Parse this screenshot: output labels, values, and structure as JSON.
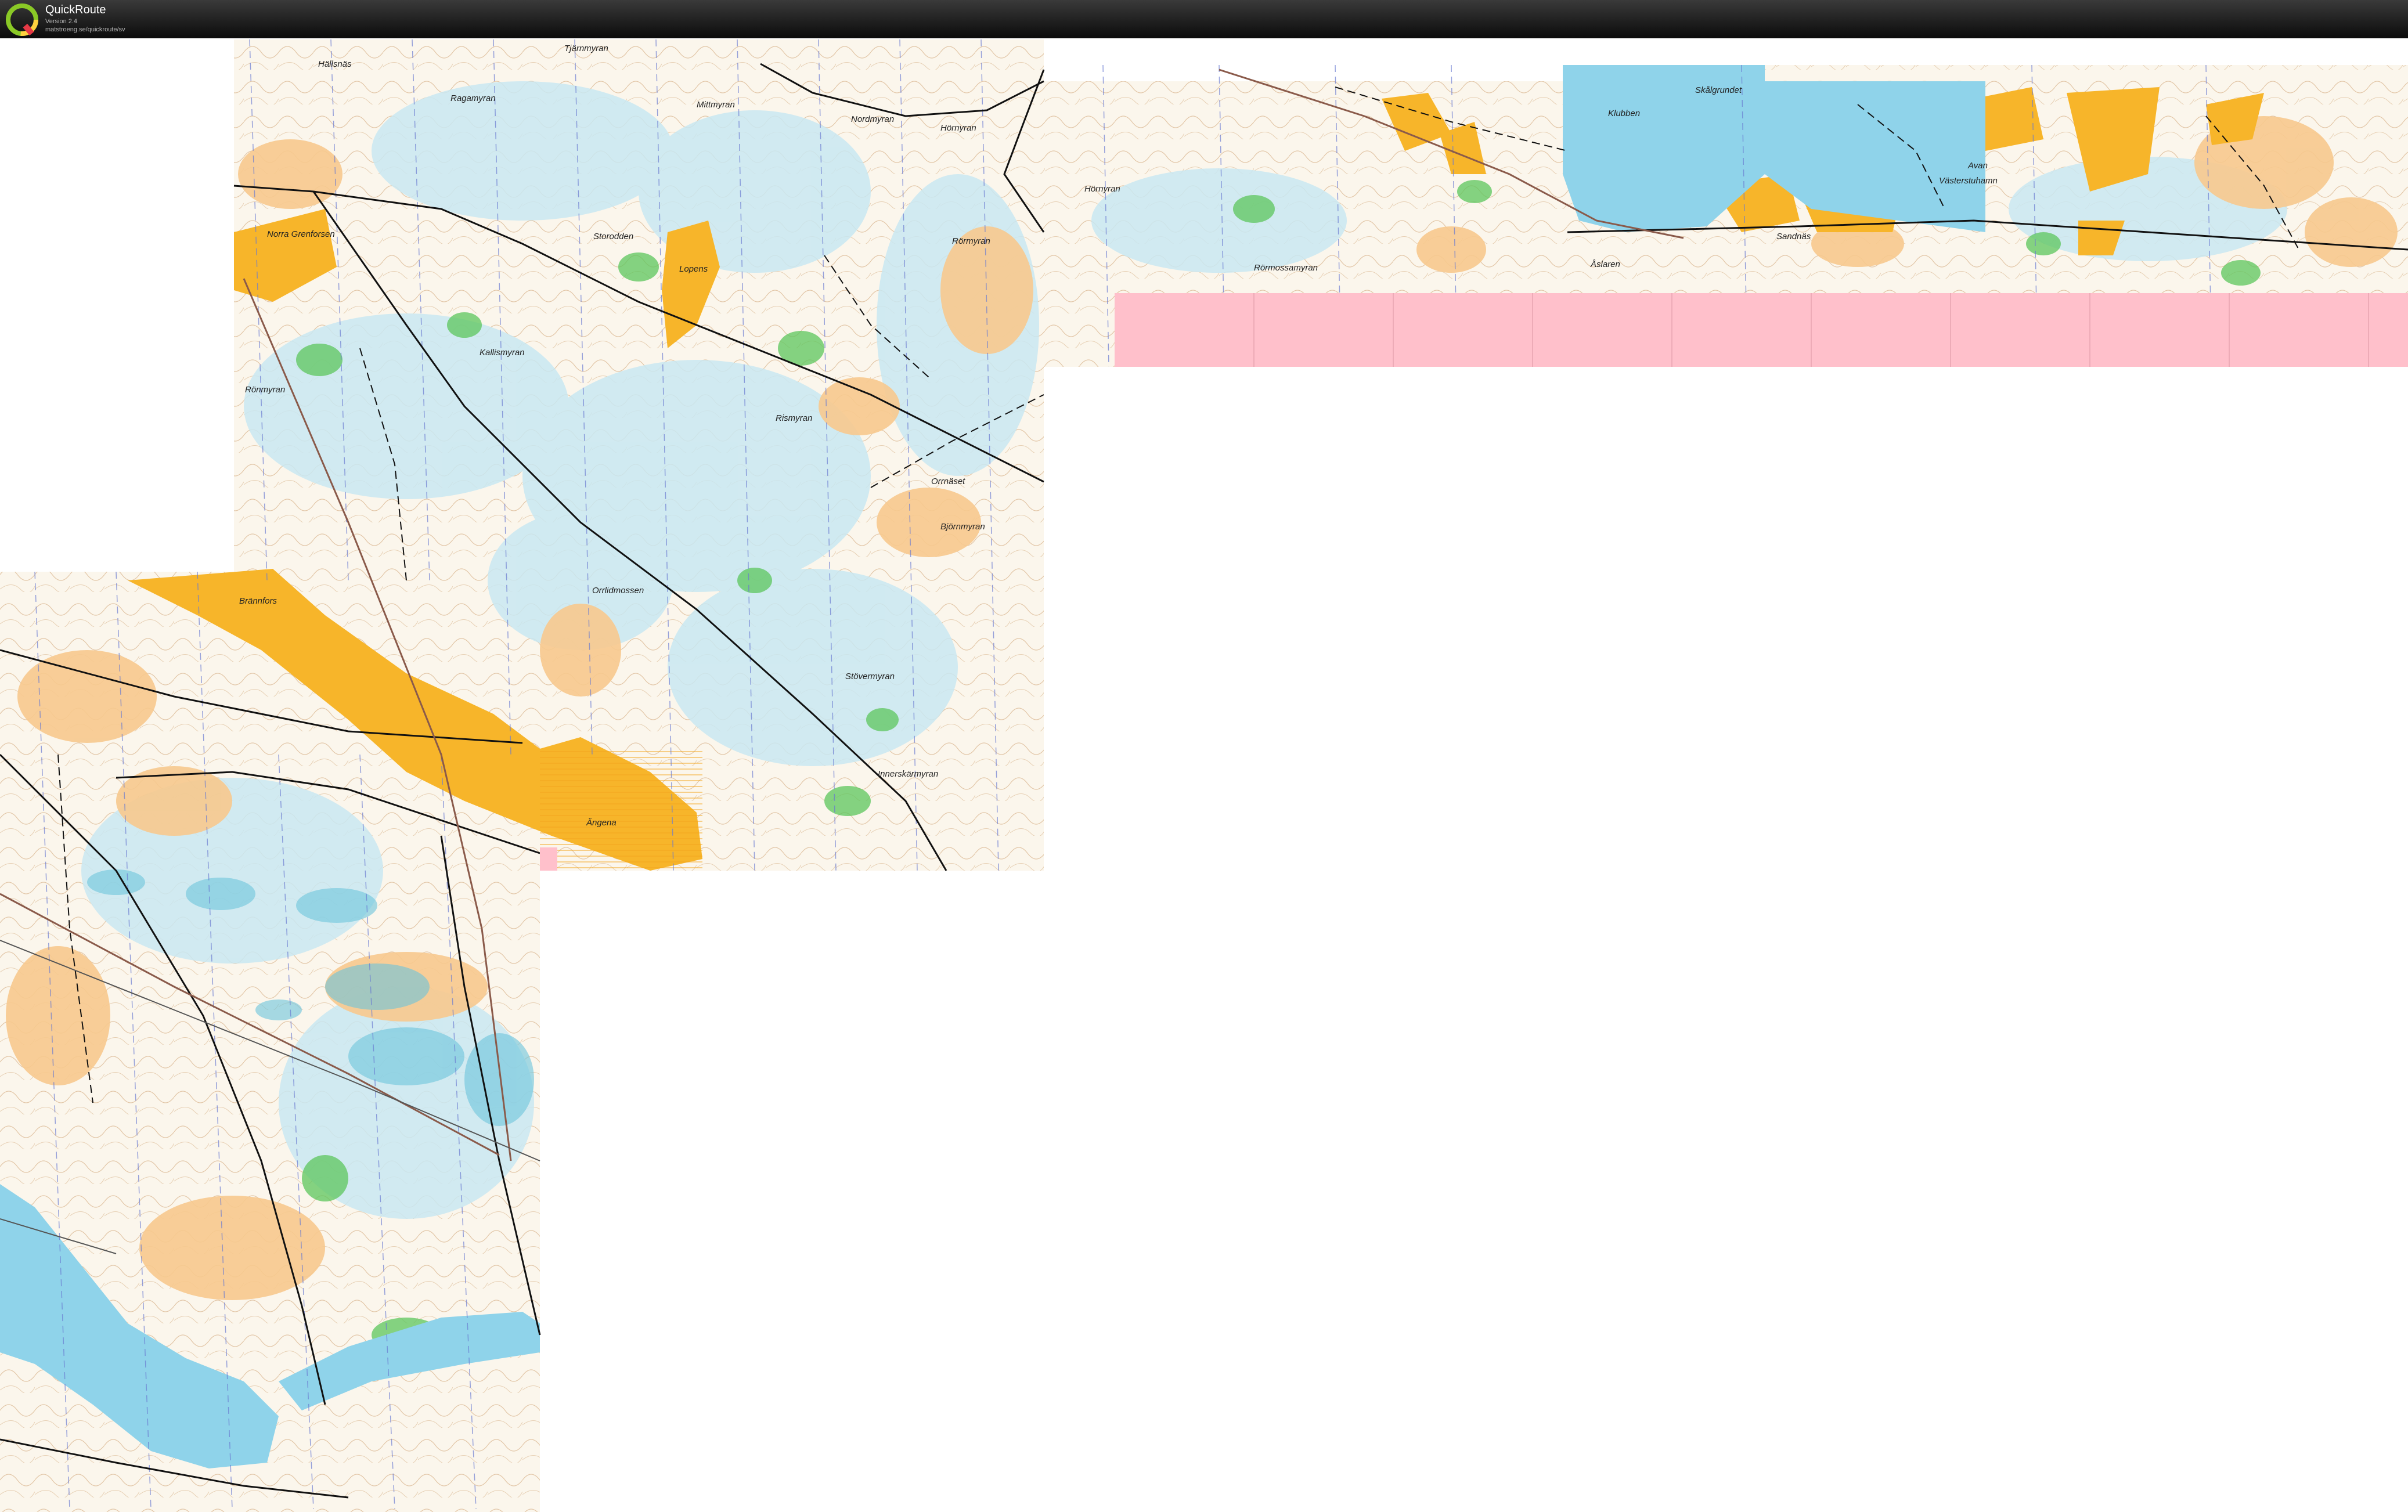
{
  "app": {
    "title": "QuickRoute",
    "version": "Version 2.4",
    "url": "matstroeng.se/quickroute/sv",
    "logo_letter": "Q"
  },
  "map": {
    "colors": {
      "open_land": "#f7c98e",
      "settlement": "#f7b52a",
      "forest_green": "#5cc65c",
      "marsh": "#c9e8f2",
      "water": "#8fd3ea",
      "contours": "#c8a073",
      "missing_tile": "#ffc0cb",
      "road": "#111111"
    },
    "place_names": [
      "Hällsnäs",
      "Ragamyran",
      "Mittmyran",
      "Nordmyran",
      "Hörnyran",
      "Tjärnmyran",
      "Norra Grenforsen",
      "Storodden",
      "Lopens",
      "Rörmyran",
      "Kallismyran",
      "Rismyran",
      "Rönmyran",
      "Orrnäset",
      "Björnmyran",
      "Brännfors",
      "Orrlidmossen",
      "Stövermyran",
      "Innerskärmyran",
      "Ängena",
      "Hörnyran",
      "Rörmossamyran",
      "Klubben",
      "Skålgrundet",
      "Sandnäs",
      "Avan",
      "Västerstuhamn",
      "Åslaren"
    ]
  }
}
